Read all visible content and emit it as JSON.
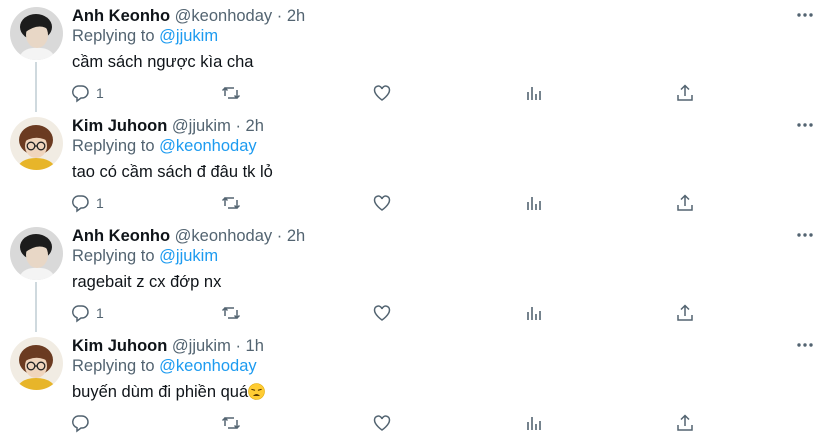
{
  "replies": [
    {
      "name": "Anh Keonho",
      "handle": "@keonhoday",
      "separator": "·",
      "time": "2h",
      "replying_prefix": "Replying to",
      "replying_to": "@jjukim",
      "text": "cầm sách ngược kìa cha",
      "reply_count": "1"
    },
    {
      "name": "Kim Juhoon",
      "handle": "@jjukim",
      "separator": "·",
      "time": "2h",
      "replying_prefix": "Replying to",
      "replying_to": "@keonhoday",
      "text": "tao có cầm sách đ đâu tk lỏ",
      "reply_count": "1"
    },
    {
      "name": "Anh Keonho",
      "handle": "@keonhoday",
      "separator": "·",
      "time": "2h",
      "replying_prefix": "Replying to",
      "replying_to": "@jjukim",
      "text": "ragebait z cx đớp nx",
      "reply_count": "1"
    },
    {
      "name": "Kim Juhoon",
      "handle": "@jjukim",
      "separator": "·",
      "time": "1h",
      "replying_prefix": "Replying to",
      "replying_to": "@keonhoday",
      "text": "buyến dùm đi phiền quá",
      "reply_count": ""
    }
  ],
  "icons": {
    "reply": "reply-icon",
    "retweet": "retweet-icon",
    "like": "heart-icon",
    "views": "views-icon",
    "share": "share-icon",
    "more": "more-icon",
    "emoji": "weary-face-emoji"
  },
  "colors": {
    "link": "#1d9bf0",
    "secondary": "#536471",
    "thread_line": "#cfd9de",
    "icon": "#536471"
  }
}
